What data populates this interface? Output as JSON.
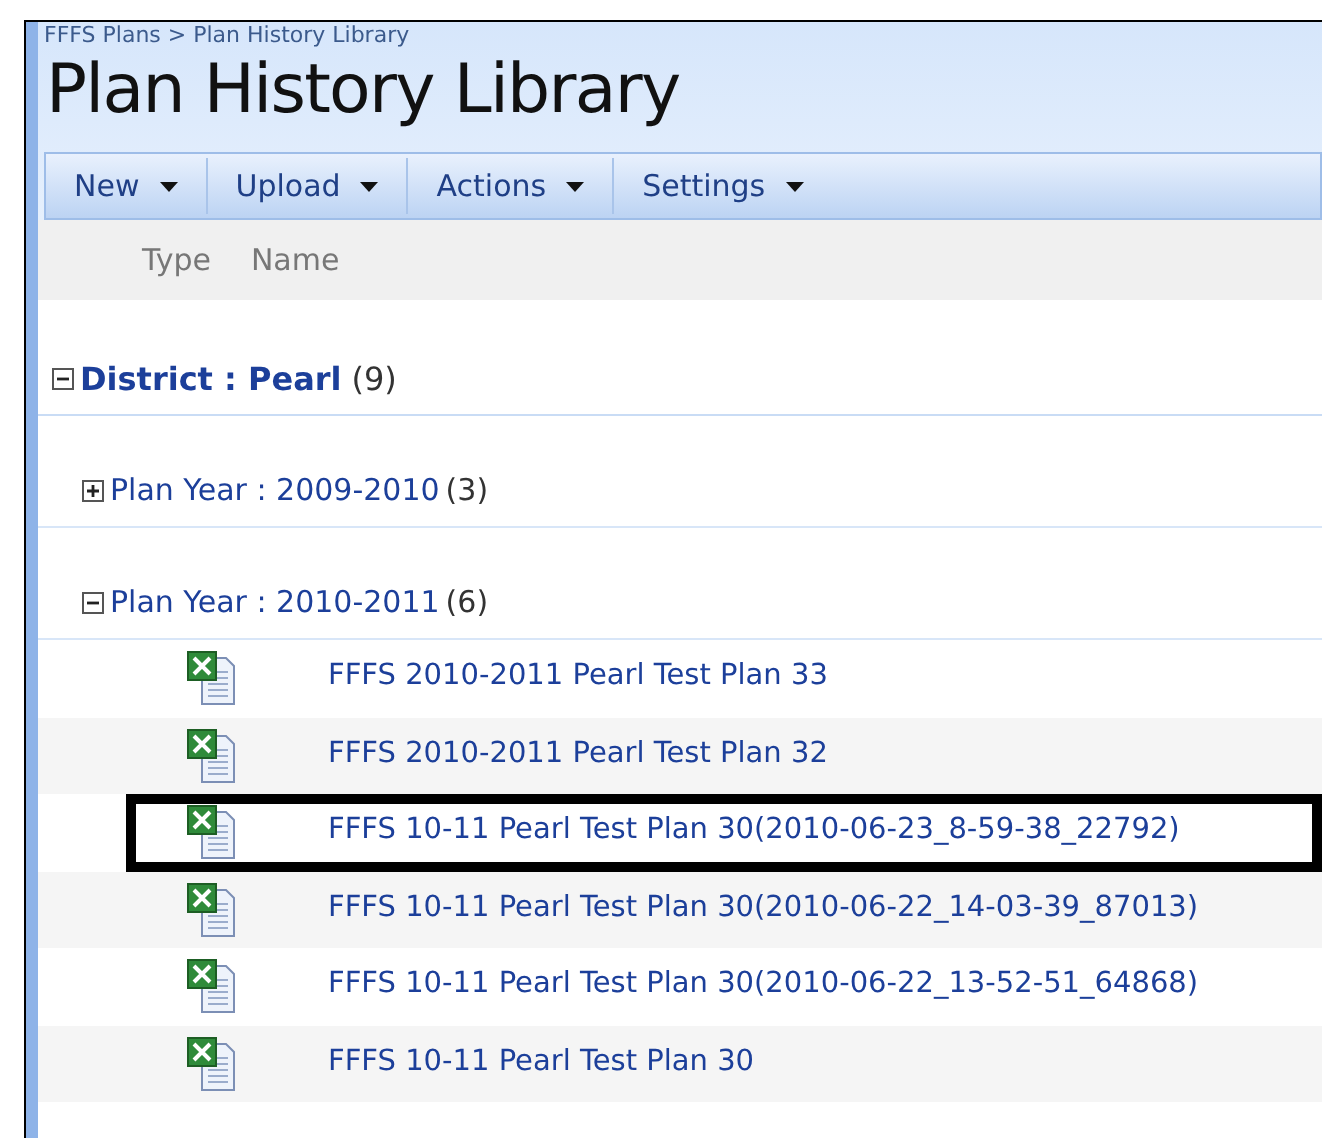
{
  "breadcrumb": "FFFS Plans > Plan History Library",
  "title": "Plan History Library",
  "toolbar": [
    {
      "label": "New"
    },
    {
      "label": "Upload"
    },
    {
      "label": "Actions"
    },
    {
      "label": "Settings"
    }
  ],
  "columns": [
    "Type",
    "Name"
  ],
  "groups": [
    {
      "label": "District : Pearl",
      "count": "(9)",
      "expanded": true,
      "children": [
        {
          "label": "Plan Year : 2009-2010",
          "count": "(3)",
          "expanded": false
        },
        {
          "label": "Plan Year : 2010-2011",
          "count": "(6)",
          "expanded": true,
          "items": [
            {
              "name": "FFFS 2010-2011 Pearl Test Plan 33",
              "highlighted": false
            },
            {
              "name": "FFFS 2010-2011 Pearl Test Plan 32",
              "highlighted": false
            },
            {
              "name": "FFFS 10-11 Pearl Test Plan 30(2010-06-23_8-59-38_22792)",
              "highlighted": true
            },
            {
              "name": "FFFS 10-11 Pearl Test Plan 30(2010-06-22_14-03-39_87013)",
              "highlighted": false
            },
            {
              "name": "FFFS 10-11 Pearl Test Plan 30(2010-06-22_13-52-51_64868)",
              "highlighted": false
            },
            {
              "name": "FFFS 10-11 Pearl Test Plan 30",
              "highlighted": false
            }
          ]
        }
      ]
    }
  ]
}
